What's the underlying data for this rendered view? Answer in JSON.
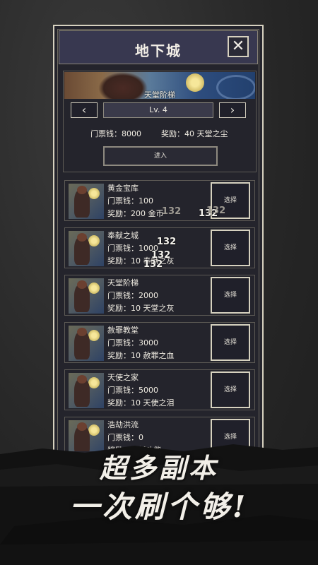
{
  "dialog": {
    "title": "地下城",
    "close_label": "✕"
  },
  "featured": {
    "name": "天堂阶梯",
    "level": "Lv. 4",
    "prev": "‹",
    "next": "›",
    "ticket": "门票钱：8000",
    "reward": "奖励：40 天堂之尘",
    "enter_label": "进入"
  },
  "dungeons": [
    {
      "name": "黄金宝库",
      "ticket": "门票钱：100",
      "reward": "奖励：200 金币",
      "button": "选择"
    },
    {
      "name": "奉献之城",
      "ticket": "门票钱：1000",
      "reward": "奖励：10 奉献之灰",
      "button": "选择"
    },
    {
      "name": "天堂阶梯",
      "ticket": "门票钱：2000",
      "reward": "奖励：10 天堂之灰",
      "button": "选择"
    },
    {
      "name": "赦罪教堂",
      "ticket": "门票钱：3000",
      "reward": "奖励：10 赦罪之血",
      "button": "选择"
    },
    {
      "name": "天使之家",
      "ticket": "门票钱：5000",
      "reward": "奖励：10 天使之泪",
      "button": "选择"
    },
    {
      "name": "浩劫洪流",
      "ticket": "门票钱：0",
      "reward": "奖励：0 新功能",
      "button": "选择"
    }
  ],
  "damage_numbers": [
    "132",
    "132",
    "132",
    "132",
    "132",
    "132"
  ],
  "slogan": {
    "line1": "超多副本",
    "line2": "一次刷个够!"
  },
  "colors": {
    "panel_bg": "#24242c",
    "header_bg": "#383850",
    "border": "#d6d1bf",
    "text": "#f0ece2"
  }
}
